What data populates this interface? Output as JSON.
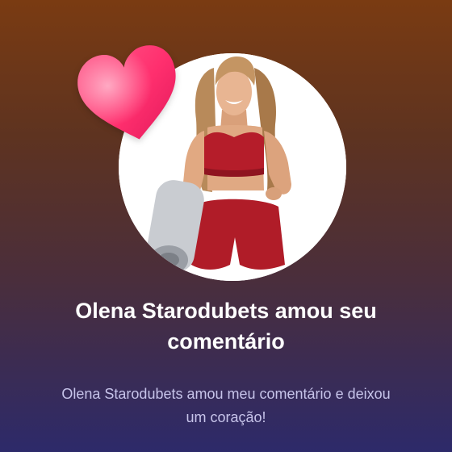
{
  "notification": {
    "title": "Olena Starodubets amou seu comentário",
    "message": "Olena Starodubets amou meu comentário e deixou um coração!",
    "avatar_alt": "Olena Starodubets",
    "icon": "heart-icon"
  },
  "colors": {
    "background_top": "#7a3b12",
    "background_bottom": "#2d2a6a",
    "heart": "#ff2f6e",
    "title": "#ffffff",
    "subtitle": "#c7c4ea"
  }
}
